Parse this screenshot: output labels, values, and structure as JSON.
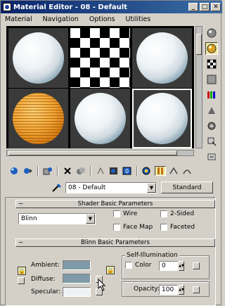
{
  "window": {
    "title": "Material Editor - 08 - Default"
  },
  "menu": [
    "Material",
    "Navigation",
    "Options",
    "Utilities"
  ],
  "material": {
    "name": "08 - Default",
    "type_button": "Standard"
  },
  "shader_rollout": {
    "title": "Shader Basic Parameters",
    "shader": "Blinn",
    "options": {
      "wire": "Wire",
      "two_sided": "2-Sided",
      "face_map": "Face Map",
      "faceted": "Faceted"
    }
  },
  "blinn_rollout": {
    "title": "Blinn Basic Parameters",
    "ambient": "Ambient:",
    "diffuse": "Diffuse:",
    "specular": "Specular:",
    "self_illum_title": "Self-Illumination",
    "color_label": "Color",
    "color_value": "0",
    "opacity_label": "Opacity:",
    "opacity_value": "100"
  },
  "colors": {
    "ambient": "#7f9aa8",
    "diffuse": "#7f9aa8",
    "specular": "#eef2f4"
  },
  "toolbar_icons": [
    "get-material-icon",
    "put-to-scene-icon",
    "assign-to-selection-icon",
    "reset-icon",
    "make-copy-icon",
    "make-unique-icon",
    "put-to-library-icon",
    "material-id-channel-icon",
    "show-map-icon",
    "show-end-result-icon",
    "go-to-parent-icon",
    "go-forward-icon",
    "pick-from-object-icon"
  ],
  "side_icons": [
    "sample-type-icon",
    "backlight-icon",
    "background-icon",
    "uv-tiling-icon",
    "video-color-check-icon",
    "make-preview-icon",
    "options-icon",
    "select-by-material-icon",
    "material-navigator-icon"
  ]
}
